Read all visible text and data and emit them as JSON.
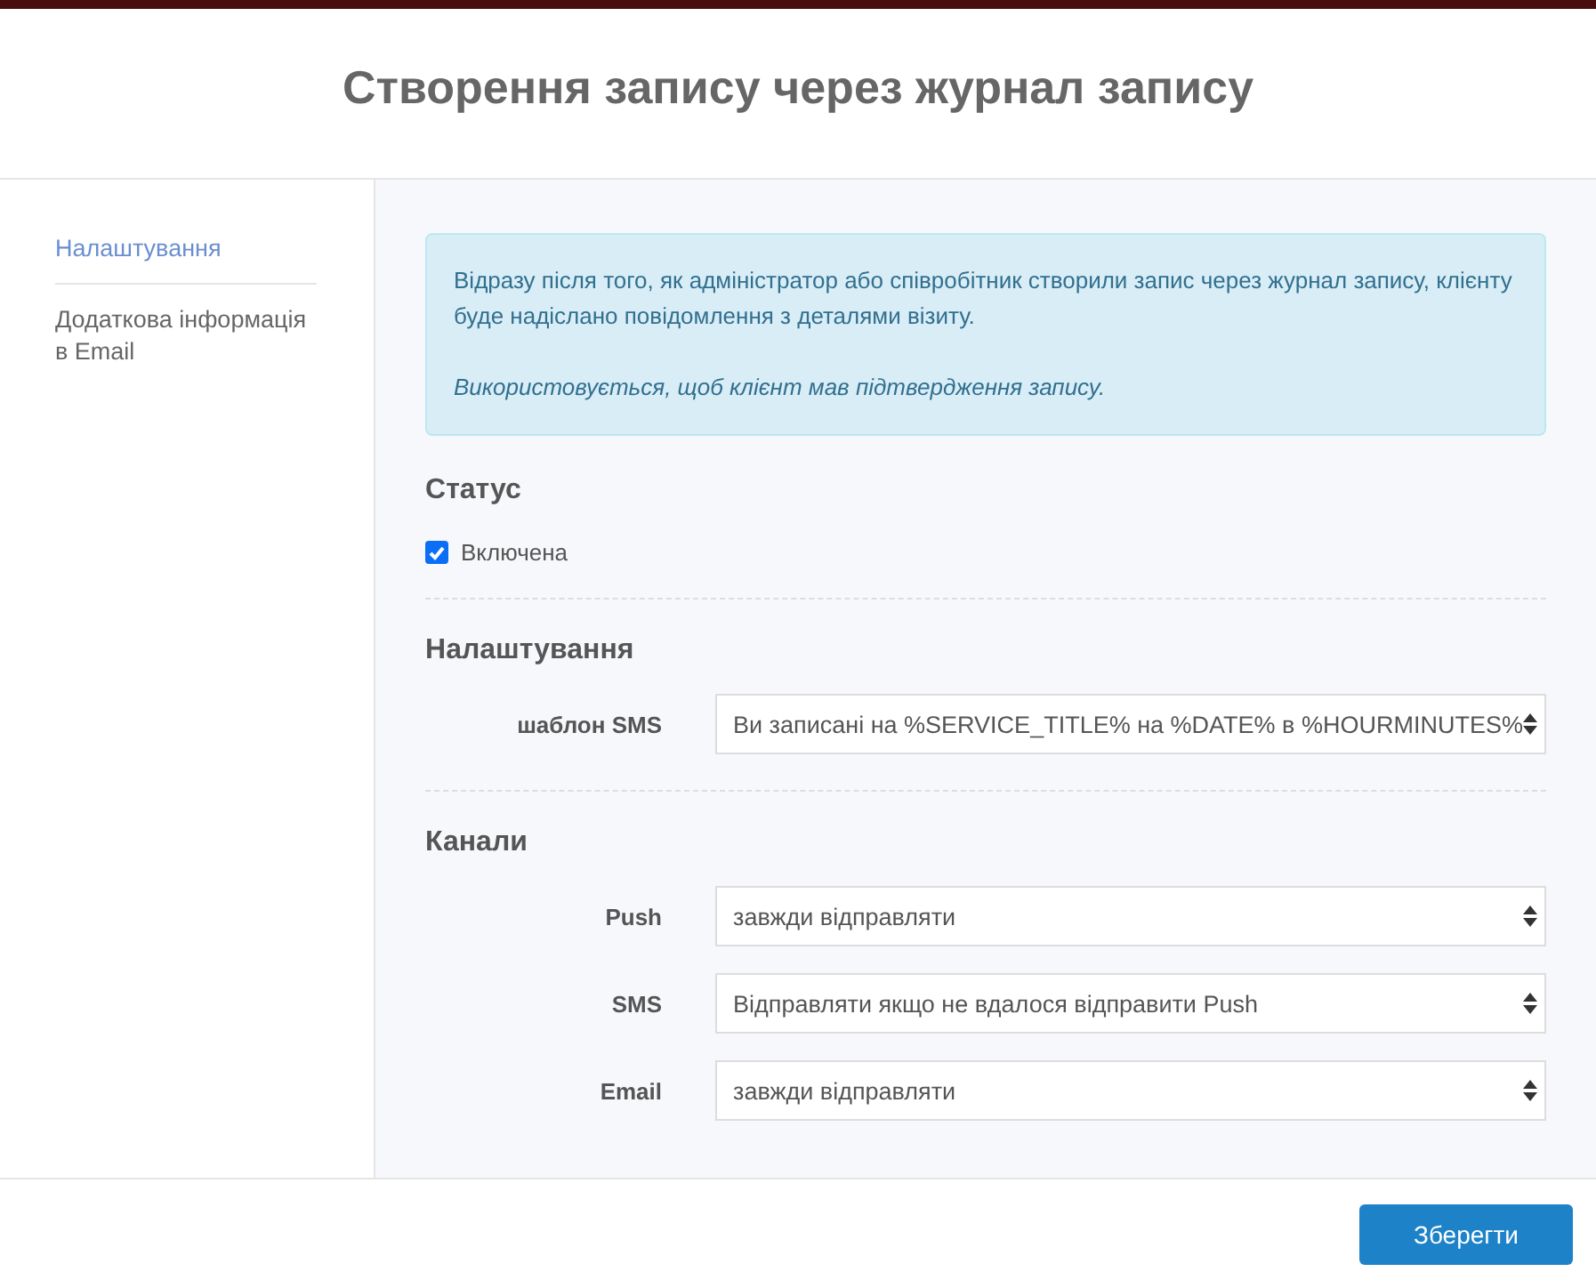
{
  "dialog": {
    "title": "Створення запису через журнал запису"
  },
  "sidebar": {
    "items": [
      {
        "label": "Налаштування",
        "selected": true
      },
      {
        "label": "Додаткова інформація в Email",
        "selected": false
      }
    ]
  },
  "info": {
    "text": "Відразу після того, як адміністратор або співробітник створили запис через журнал запису, клієнту буде надіслано повідомлення з деталями візиту.",
    "note": "Використовується, щоб клієнт мав підтвердження запису."
  },
  "status": {
    "heading": "Статус",
    "checkbox": {
      "label": "Включена",
      "checked": true
    }
  },
  "settings": {
    "heading": "Налаштування",
    "fields": [
      {
        "label": "шаблон SMS",
        "value": "Ви записані на %SERVICE_TITLE% на %DATE% в %HOURMINUTES%"
      }
    ]
  },
  "channels": {
    "heading": "Канали",
    "fields": [
      {
        "label": "Push",
        "value": "завжди відправляти"
      },
      {
        "label": "SMS",
        "value": "Відправляти якщо не вдалося відправити Push"
      },
      {
        "label": "Email",
        "value": "завжди відправляти"
      }
    ]
  },
  "footer": {
    "save_button": "Зберегти"
  }
}
